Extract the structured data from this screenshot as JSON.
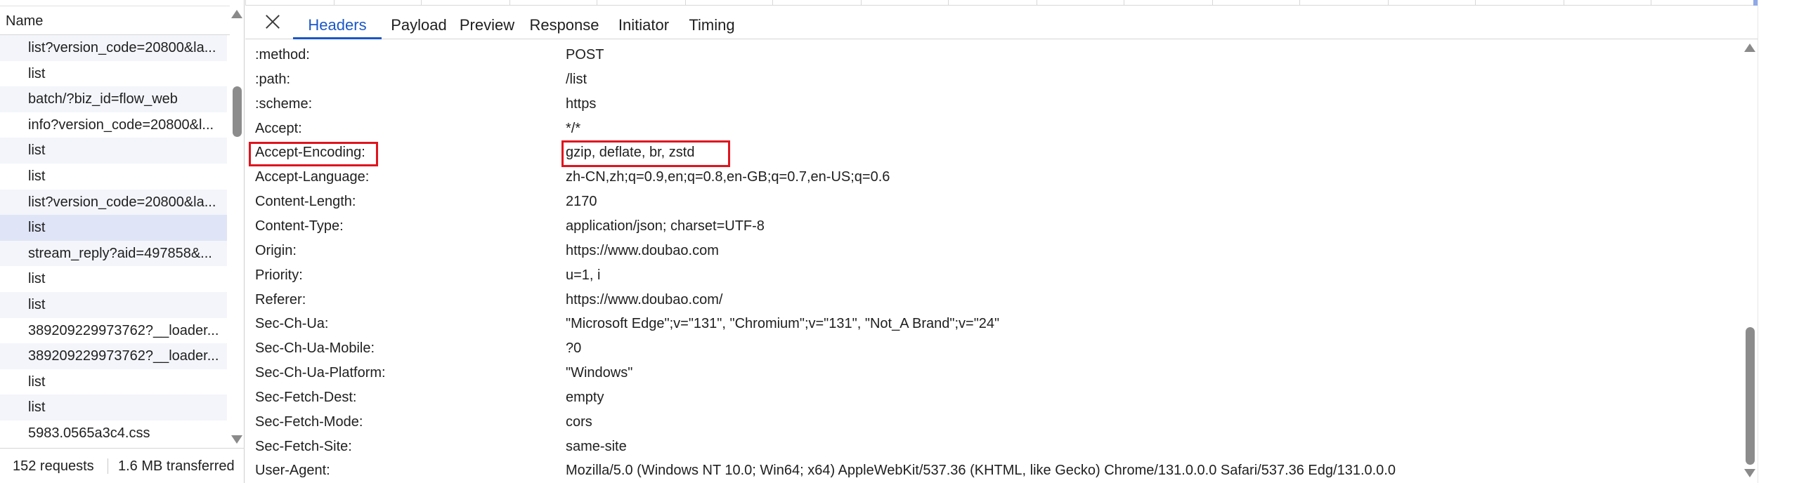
{
  "network": {
    "name_header": "Name",
    "requests": [
      "list?version_code=20800&la...",
      "list",
      "batch/?biz_id=flow_web",
      "info?version_code=20800&l...",
      "list",
      "list",
      "list?version_code=20800&la...",
      "list",
      "stream_reply?aid=497858&...",
      "list",
      "list",
      "389209229973762?__loader...",
      "389209229973762?__loader...",
      "list",
      "list",
      "5983.0565a3c4.css"
    ],
    "selected_index": 7,
    "status": {
      "requests": "152 requests",
      "transferred": "1.6 MB transferred"
    }
  },
  "tabs": {
    "close_icon": "close-icon",
    "headers": "Headers",
    "payload": "Payload",
    "preview": "Preview",
    "response": "Response",
    "initiator": "Initiator",
    "timing": "Timing",
    "active": "Headers"
  },
  "headers": [
    {
      "name": ":method:",
      "value": "POST"
    },
    {
      "name": ":path:",
      "value": "/list"
    },
    {
      "name": ":scheme:",
      "value": "https"
    },
    {
      "name": "Accept:",
      "value": "*/*"
    },
    {
      "name": "Accept-Encoding:",
      "value": "gzip, deflate, br, zstd"
    },
    {
      "name": "Accept-Language:",
      "value": "zh-CN,zh;q=0.9,en;q=0.8,en-GB;q=0.7,en-US;q=0.6"
    },
    {
      "name": "Content-Length:",
      "value": "2170"
    },
    {
      "name": "Content-Type:",
      "value": "application/json; charset=UTF-8"
    },
    {
      "name": "Origin:",
      "value": "https://www.doubao.com"
    },
    {
      "name": "Priority:",
      "value": "u=1, i"
    },
    {
      "name": "Referer:",
      "value": "https://www.doubao.com/"
    },
    {
      "name": "Sec-Ch-Ua:",
      "value": "\"Microsoft Edge\";v=\"131\", \"Chromium\";v=\"131\", \"Not_A Brand\";v=\"24\""
    },
    {
      "name": "Sec-Ch-Ua-Mobile:",
      "value": "?0"
    },
    {
      "name": "Sec-Ch-Ua-Platform:",
      "value": "\"Windows\""
    },
    {
      "name": "Sec-Fetch-Dest:",
      "value": "empty"
    },
    {
      "name": "Sec-Fetch-Mode:",
      "value": "cors"
    },
    {
      "name": "Sec-Fetch-Site:",
      "value": "same-site"
    },
    {
      "name": "User-Agent:",
      "value": "Mozilla/5.0 (Windows NT 10.0; Win64; x64) AppleWebKit/537.36 (KHTML, like Gecko) Chrome/131.0.0.0 Safari/537.36 Edg/131.0.0.0"
    }
  ],
  "highlighted_header": "Accept-Encoding:",
  "colors": {
    "accent": "#1a57c8",
    "highlight_box": "#e0141e",
    "selected_row": "#dfe5f7"
  }
}
